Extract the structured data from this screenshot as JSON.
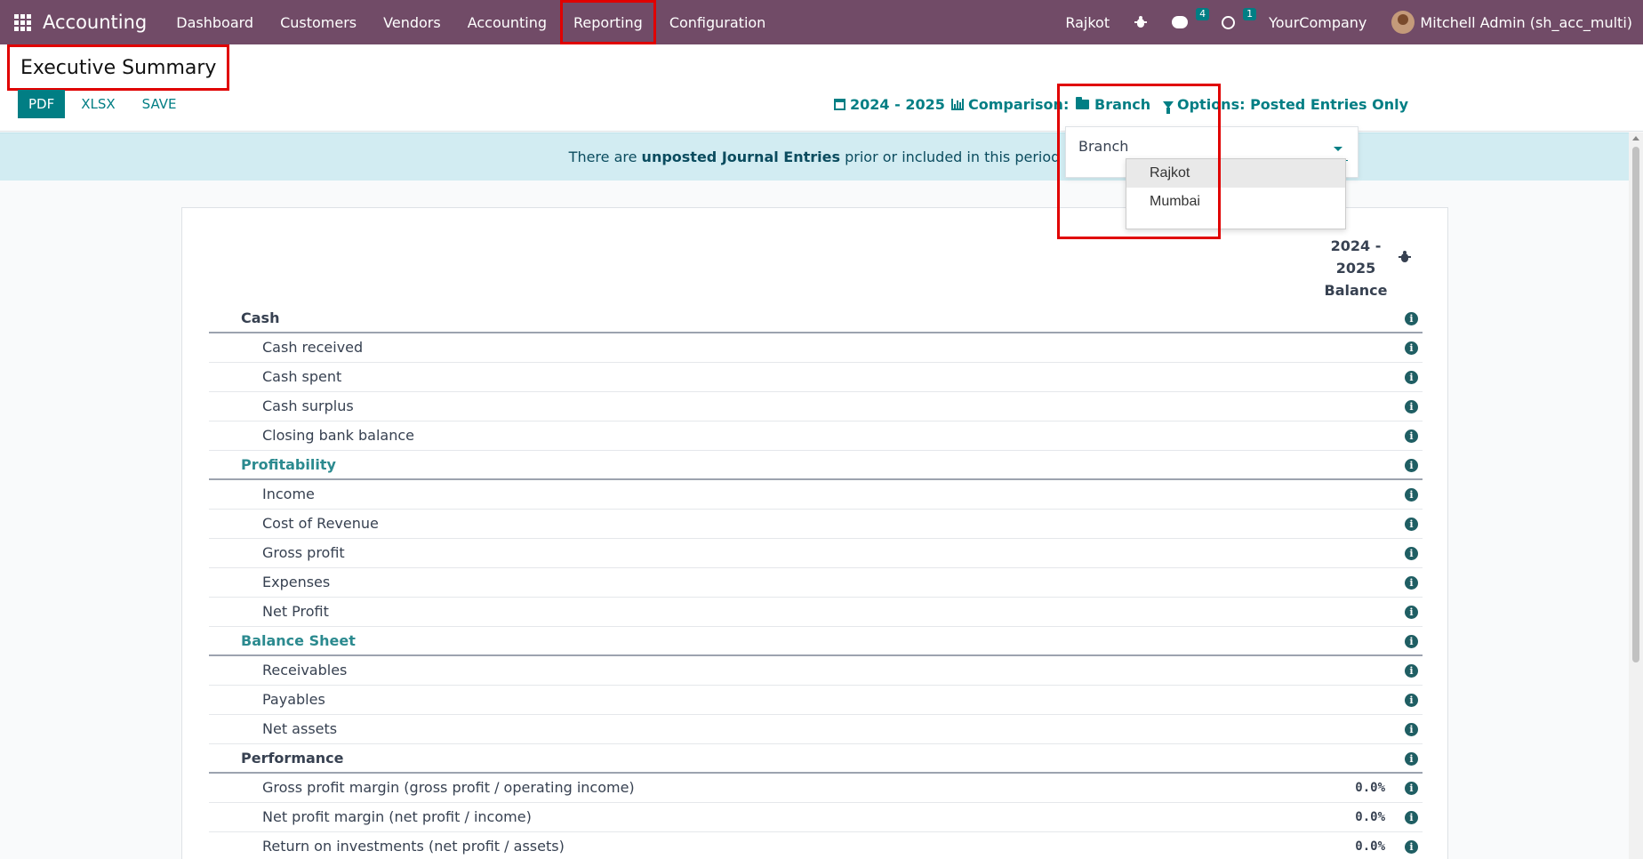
{
  "navbar": {
    "app_name": "Accounting",
    "menu": [
      "Dashboard",
      "Customers",
      "Vendors",
      "Accounting",
      "Reporting",
      "Configuration"
    ],
    "branch": "Rajkot",
    "messages_count": "4",
    "activities_count": "1",
    "company": "YourCompany",
    "user": "Mitchell Admin (sh_acc_multi)"
  },
  "page": {
    "title": "Executive Summary",
    "buttons": {
      "pdf": "PDF",
      "xlsx": "XLSX",
      "save": "SAVE"
    }
  },
  "filters": {
    "period": "2024 - 2025",
    "comparison": "Comparison:",
    "branch": "Branch",
    "options_prefix": "Options",
    "options_suffix": ": Posted Entries Only"
  },
  "alert": {
    "prefix": "There are ",
    "bold": "unposted Journal Entries",
    "suffix": " prior or included in this period"
  },
  "branch_dropdown": {
    "label": "Branch",
    "options": [
      "Rajkot",
      "Mumbai"
    ]
  },
  "report": {
    "column_header": [
      "2024 -",
      "2025",
      "Balance"
    ],
    "rows": [
      {
        "label": "Cash",
        "type": "section"
      },
      {
        "label": "Cash received",
        "type": "line"
      },
      {
        "label": "Cash spent",
        "type": "line"
      },
      {
        "label": "Cash surplus",
        "type": "line"
      },
      {
        "label": "Closing bank balance",
        "type": "line"
      },
      {
        "label": "Profitability",
        "type": "section-teal"
      },
      {
        "label": "Income",
        "type": "line"
      },
      {
        "label": "Cost of Revenue",
        "type": "line"
      },
      {
        "label": "Gross profit",
        "type": "line"
      },
      {
        "label": "Expenses",
        "type": "line"
      },
      {
        "label": "Net Profit",
        "type": "line"
      },
      {
        "label": "Balance Sheet",
        "type": "section-teal"
      },
      {
        "label": "Receivables",
        "type": "line"
      },
      {
        "label": "Payables",
        "type": "line"
      },
      {
        "label": "Net assets",
        "type": "line"
      },
      {
        "label": "Performance",
        "type": "section"
      },
      {
        "label": "Gross profit margin (gross profit / operating income)",
        "type": "line",
        "value": "0.0%"
      },
      {
        "label": "Net profit margin (net profit / income)",
        "type": "line",
        "value": "0.0%"
      },
      {
        "label": "Return on investments (net profit / assets)",
        "type": "line",
        "value": "0.0%"
      }
    ]
  },
  "colors": {
    "navbar": "#714b67",
    "accent": "#017e84",
    "alert_bg": "#d2ecf2",
    "highlight": "#e00000"
  }
}
